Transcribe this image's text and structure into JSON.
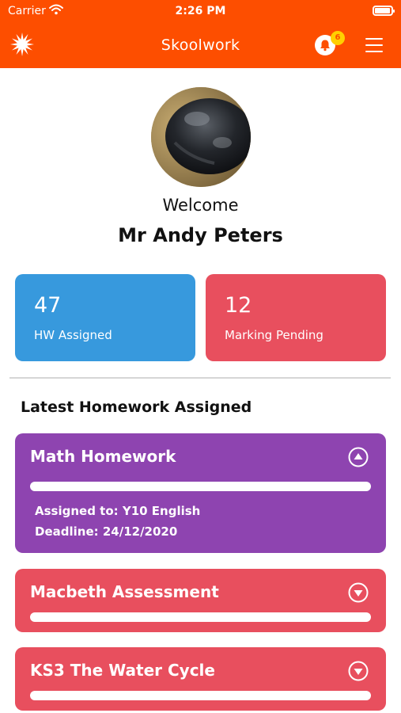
{
  "status_bar": {
    "carrier": "Carrier",
    "time": "2:26 PM"
  },
  "header": {
    "title": "Skoolwork",
    "notification_count": "6",
    "bg_color": "#fd4e00"
  },
  "profile": {
    "welcome": "Welcome",
    "name": "Mr Andy Peters"
  },
  "stats": [
    {
      "value": "47",
      "label": "HW Assigned",
      "color": "#3799dd"
    },
    {
      "value": "12",
      "label": "Marking Pending",
      "color": "#e84f5e"
    }
  ],
  "section": {
    "title": "Latest Homework Assigned"
  },
  "homework": [
    {
      "title": "Math Homework",
      "expanded": true,
      "assigned_to": "Assigned to: Y10 English",
      "deadline": "Deadline: 24/12/2020",
      "color": "#8e44b0",
      "toggle_icon": "chevron-up-circle-icon"
    },
    {
      "title": "Macbeth Assessment",
      "expanded": false,
      "color": "#e84f5e",
      "toggle_icon": "chevron-down-circle-icon"
    },
    {
      "title": "KS3 The Water Cycle",
      "expanded": false,
      "color": "#e84f5e",
      "toggle_icon": "chevron-down-circle-icon"
    }
  ]
}
